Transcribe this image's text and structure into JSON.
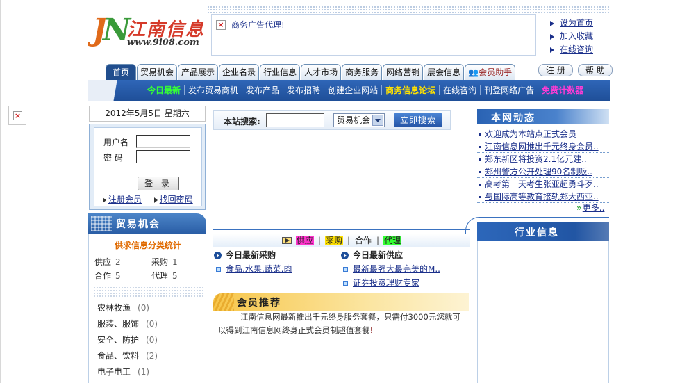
{
  "header": {
    "logo_letters": "JN",
    "logo_text": "江南信息",
    "logo_url": "www.9i08.com",
    "ad_text": "商务广告代理!",
    "quick_links": [
      "设为首页",
      "加入收藏",
      "在线咨询"
    ],
    "register_btn": "注 册",
    "help_btn": "帮 助"
  },
  "tabs": [
    "首页",
    "贸易机会",
    "产品展示",
    "企业名录",
    "行业信息",
    "人才市场",
    "商务服务",
    "网络营销",
    "展会信息",
    "会员助手"
  ],
  "navbar": {
    "items": [
      "今日最新",
      "发布贸易商机",
      "发布产品",
      "发布招聘",
      "创建企业网站",
      "商务信息论坛",
      "在线咨询",
      "刊登网络广告",
      "免费计数器"
    ]
  },
  "left": {
    "date": "2012年5月5日 星期六",
    "login": {
      "username_label": "用户名",
      "password_label": "密 码",
      "login_btn": "登 录",
      "register_link": "注册会员",
      "recover_link": "找回密码"
    },
    "trade_title": "贸易机会",
    "stats_title": "供求信息分类统计",
    "stats": [
      {
        "label": "供应",
        "count": "2"
      },
      {
        "label": "采购",
        "count": "1"
      },
      {
        "label": "合作",
        "count": "5"
      },
      {
        "label": "代理",
        "count": "5"
      }
    ],
    "categories": [
      {
        "name": "农林牧渔",
        "count": "(0)"
      },
      {
        "name": "服装、服饰",
        "count": "(0)"
      },
      {
        "name": "安全、防护",
        "count": "(0)"
      },
      {
        "name": "食品、饮料",
        "count": "(2)"
      },
      {
        "name": "电子电工",
        "count": "(1)"
      }
    ]
  },
  "middle": {
    "search_label": "本站搜索:",
    "search_select": "贸易机会",
    "search_btn": "立即搜索",
    "legend": {
      "supply": "供应",
      "purchase": "采购",
      "cooperate": "合作",
      "agent": "代理",
      "colors": {
        "supply": "#ff33cc",
        "purchase": "#ffe100",
        "cooperate": "#ffffff",
        "agent": "#33ff33"
      }
    },
    "latest_purchase_title": "今日最新采购",
    "latest_purchase": [
      "食品,水果,蔬菜,肉"
    ],
    "latest_supply_title": "今日最新供应",
    "latest_supply": [
      "最新最强大最完美的M..",
      "证券投资理财专家"
    ],
    "member_title": "会员推荐",
    "member_text_1": "江南信息网最新推出千元终身服务套餐，只需付3000元您就可以得到江南信息网终身正式会员制超值套餐",
    "member_text_2": "!"
  },
  "right": {
    "news_title": "本网动态",
    "news": [
      "欢迎成为本站点正式会员",
      "江南信息网推出千元终身会员..",
      "郑东新区将投资2.1亿元建..",
      "郑州警方公开处理90名制贩..",
      "高考第一天考生张亚超勇斗歹..",
      "与国际高等教育接轨郑大西亚.."
    ],
    "more": "更多..",
    "industry_title": "行业信息"
  }
}
